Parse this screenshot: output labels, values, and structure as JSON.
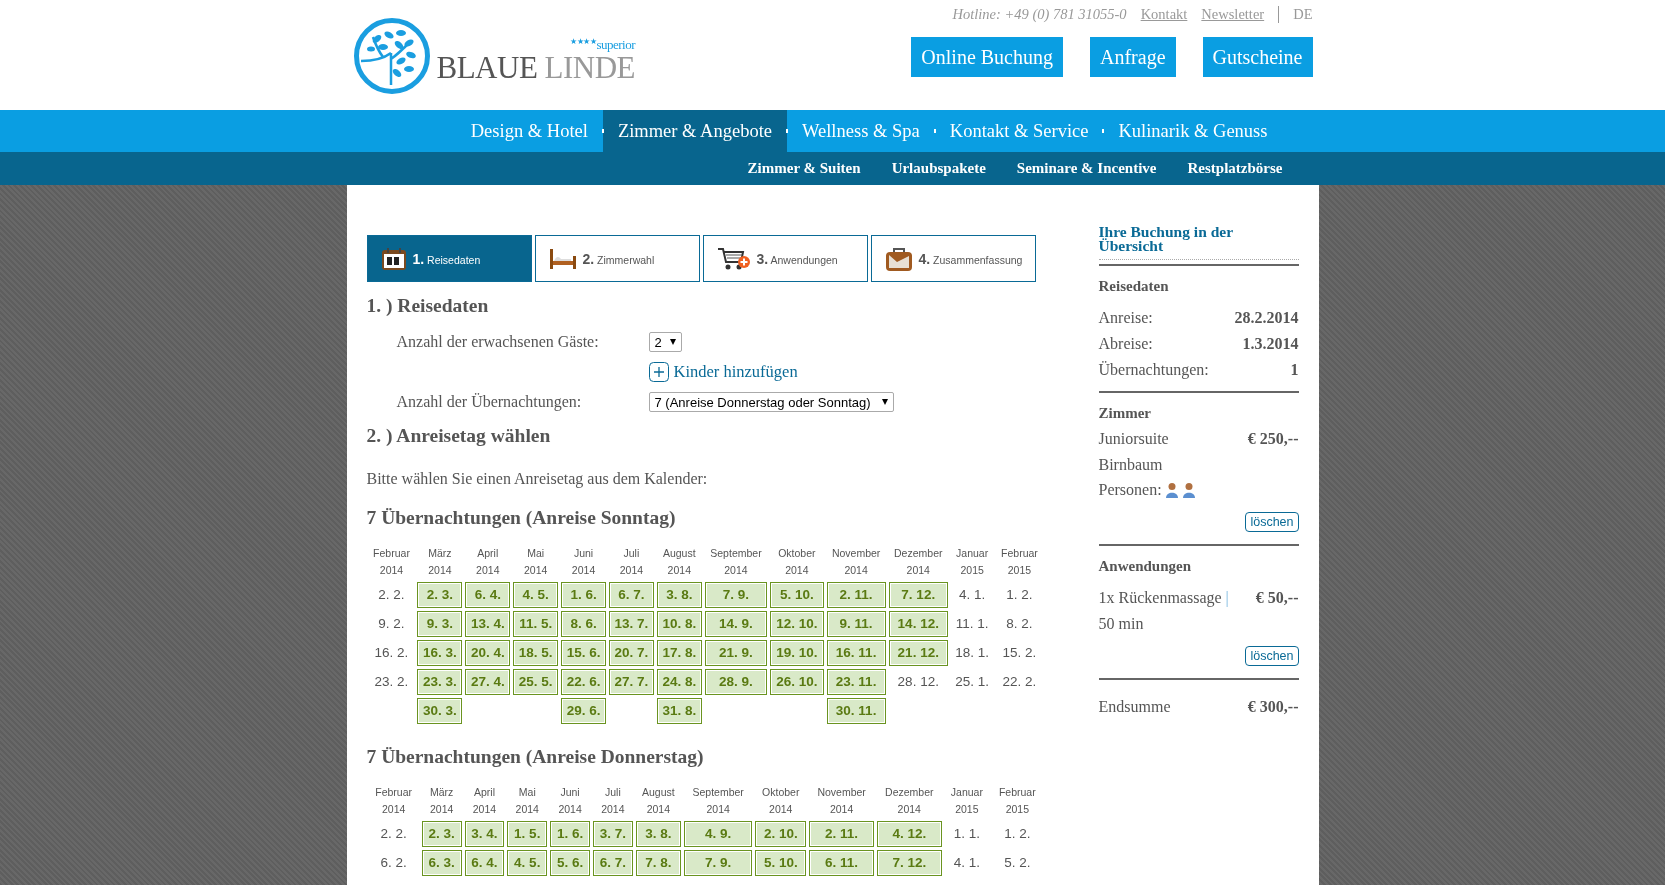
{
  "header": {
    "logo": {
      "brand_first": "BLAUE",
      "brand_second": "LINDE",
      "stars": "★★★★",
      "rating": "superior"
    },
    "hotline": "Hotline: +49 (0) 781 31055-0",
    "links": [
      "Kontakt",
      "Newsletter"
    ],
    "language": "DE",
    "buttons": [
      "Online Buchung",
      "Anfrage",
      "Gutscheine"
    ]
  },
  "main_nav": [
    {
      "label": "Design & Hotel",
      "selected": false
    },
    {
      "label": "Zimmer & Angebote",
      "selected": true
    },
    {
      "label": "Wellness & Spa",
      "selected": false
    },
    {
      "label": "Kontakt & Service",
      "selected": false
    },
    {
      "label": "Kulinarik & Genuss",
      "selected": false
    }
  ],
  "sub_nav": [
    "Zimmer & Suiten",
    "Urlaubspakete",
    "Seminare & Incentive",
    "Restplatzbörse"
  ],
  "steps": [
    {
      "number": "1.",
      "label": "Reisedaten",
      "kind": "calendar",
      "selected": true
    },
    {
      "number": "2.",
      "label": "Zimmerwahl",
      "kind": "bed",
      "selected": false
    },
    {
      "number": "3.",
      "label": "Anwendungen",
      "kind": "cart",
      "selected": false
    },
    {
      "number": "4.",
      "label": "Zusammenfassung",
      "kind": "suitcase",
      "selected": false
    }
  ],
  "travel_dates": {
    "heading": "1. ) Reisedaten",
    "guests_label": "Anzahl der erwachsenen Gäste:",
    "guests_value": "2",
    "add_children": "Kinder hinzufügen",
    "nights_label": "Anzahl der Übernachtungen:",
    "nights_value": "7 (Anreise Donnerstag oder Sonntag)"
  },
  "arrival": {
    "heading": "2. ) Anreisetag wählen",
    "instruction": "Bitte wählen Sie einen Anreisetag aus dem Kalender:"
  },
  "calendars": [
    {
      "title": "7 Übernachtungen (Anreise Sonntag)",
      "months": [
        {
          "name": "Februar",
          "year": "2014",
          "days": [
            {
              "label": "2. 2.",
              "available": false
            },
            {
              "label": "9. 2.",
              "available": false
            },
            {
              "label": "16. 2.",
              "available": false
            },
            {
              "label": "23. 2.",
              "available": false
            }
          ]
        },
        {
          "name": "März",
          "year": "2014",
          "days": [
            {
              "label": "2. 3.",
              "available": true
            },
            {
              "label": "9. 3.",
              "available": true
            },
            {
              "label": "16. 3.",
              "available": true
            },
            {
              "label": "23. 3.",
              "available": true
            },
            {
              "label": "30. 3.",
              "available": true
            }
          ]
        },
        {
          "name": "April",
          "year": "2014",
          "days": [
            {
              "label": "6. 4.",
              "available": true
            },
            {
              "label": "13. 4.",
              "available": true
            },
            {
              "label": "20. 4.",
              "available": true
            },
            {
              "label": "27. 4.",
              "available": true
            }
          ]
        },
        {
          "name": "Mai",
          "year": "2014",
          "days": [
            {
              "label": "4. 5.",
              "available": true
            },
            {
              "label": "11. 5.",
              "available": true
            },
            {
              "label": "18. 5.",
              "available": true
            },
            {
              "label": "25. 5.",
              "available": true
            }
          ]
        },
        {
          "name": "Juni",
          "year": "2014",
          "days": [
            {
              "label": "1. 6.",
              "available": true
            },
            {
              "label": "8. 6.",
              "available": true
            },
            {
              "label": "15. 6.",
              "available": true
            },
            {
              "label": "22. 6.",
              "available": true
            },
            {
              "label": "29. 6.",
              "available": true
            }
          ]
        },
        {
          "name": "Juli",
          "year": "2014",
          "days": [
            {
              "label": "6. 7.",
              "available": true
            },
            {
              "label": "13. 7.",
              "available": true
            },
            {
              "label": "20. 7.",
              "available": true
            },
            {
              "label": "27. 7.",
              "available": true
            }
          ]
        },
        {
          "name": "August",
          "year": "2014",
          "days": [
            {
              "label": "3. 8.",
              "available": true
            },
            {
              "label": "10. 8.",
              "available": true
            },
            {
              "label": "17. 8.",
              "available": true
            },
            {
              "label": "24. 8.",
              "available": true
            },
            {
              "label": "31. 8.",
              "available": true
            }
          ]
        },
        {
          "name": "September",
          "year": "2014",
          "days": [
            {
              "label": "7. 9.",
              "available": true
            },
            {
              "label": "14. 9.",
              "available": true
            },
            {
              "label": "21. 9.",
              "available": true
            },
            {
              "label": "28. 9.",
              "available": true
            }
          ]
        },
        {
          "name": "Oktober",
          "year": "2014",
          "days": [
            {
              "label": "5. 10.",
              "available": true
            },
            {
              "label": "12. 10.",
              "available": true
            },
            {
              "label": "19. 10.",
              "available": true
            },
            {
              "label": "26. 10.",
              "available": true
            }
          ]
        },
        {
          "name": "November",
          "year": "2014",
          "days": [
            {
              "label": "2. 11.",
              "available": true
            },
            {
              "label": "9. 11.",
              "available": true
            },
            {
              "label": "16. 11.",
              "available": true
            },
            {
              "label": "23. 11.",
              "available": true
            },
            {
              "label": "30. 11.",
              "available": true
            }
          ]
        },
        {
          "name": "Dezember",
          "year": "2014",
          "days": [
            {
              "label": "7. 12.",
              "available": true
            },
            {
              "label": "14. 12.",
              "available": true
            },
            {
              "label": "21. 12.",
              "available": true
            },
            {
              "label": "28. 12.",
              "available": false
            }
          ]
        },
        {
          "name": "Januar",
          "year": "2015",
          "days": [
            {
              "label": "4. 1.",
              "available": false
            },
            {
              "label": "11. 1.",
              "available": false
            },
            {
              "label": "18. 1.",
              "available": false
            },
            {
              "label": "25. 1.",
              "available": false
            }
          ]
        },
        {
          "name": "Februar",
          "year": "2015",
          "days": [
            {
              "label": "1. 2.",
              "available": false
            },
            {
              "label": "8. 2.",
              "available": false
            },
            {
              "label": "15. 2.",
              "available": false
            },
            {
              "label": "22. 2.",
              "available": false
            }
          ]
        }
      ]
    },
    {
      "title": "7 Übernachtungen (Anreise Donnerstag)",
      "months": [
        {
          "name": "Februar",
          "year": "2014",
          "days": [
            {
              "label": "2. 2.",
              "available": false
            },
            {
              "label": "6. 2.",
              "available": false
            }
          ]
        },
        {
          "name": "März",
          "year": "2014",
          "days": [
            {
              "label": "2. 3.",
              "available": true
            },
            {
              "label": "6. 3.",
              "available": true
            }
          ]
        },
        {
          "name": "April",
          "year": "2014",
          "days": [
            {
              "label": "3. 4.",
              "available": true
            },
            {
              "label": "6. 4.",
              "available": true
            }
          ]
        },
        {
          "name": "Mai",
          "year": "2014",
          "days": [
            {
              "label": "1. 5.",
              "available": true
            },
            {
              "label": "4. 5.",
              "available": true
            }
          ]
        },
        {
          "name": "Juni",
          "year": "2014",
          "days": [
            {
              "label": "1. 6.",
              "available": true
            },
            {
              "label": "5. 6.",
              "available": true
            }
          ]
        },
        {
          "name": "Juli",
          "year": "2014",
          "days": [
            {
              "label": "3. 7.",
              "available": true
            },
            {
              "label": "6. 7.",
              "available": true
            }
          ]
        },
        {
          "name": "August",
          "year": "2014",
          "days": [
            {
              "label": "3. 8.",
              "available": true
            },
            {
              "label": "7. 8.",
              "available": true
            }
          ]
        },
        {
          "name": "September",
          "year": "2014",
          "days": [
            {
              "label": "4. 9.",
              "available": true
            },
            {
              "label": "7. 9.",
              "available": true
            }
          ]
        },
        {
          "name": "Oktober",
          "year": "2014",
          "days": [
            {
              "label": "2. 10.",
              "available": true
            },
            {
              "label": "5. 10.",
              "available": true
            }
          ]
        },
        {
          "name": "November",
          "year": "2014",
          "days": [
            {
              "label": "2. 11.",
              "available": true
            },
            {
              "label": "6. 11.",
              "available": true
            }
          ]
        },
        {
          "name": "Dezember",
          "year": "2014",
          "days": [
            {
              "label": "4. 12.",
              "available": true
            },
            {
              "label": "7. 12.",
              "available": true
            }
          ]
        },
        {
          "name": "Januar",
          "year": "2015",
          "days": [
            {
              "label": "1. 1.",
              "available": false
            },
            {
              "label": "4. 1.",
              "available": false
            }
          ]
        },
        {
          "name": "Februar",
          "year": "2015",
          "days": [
            {
              "label": "1. 2.",
              "available": false
            },
            {
              "label": "5. 2.",
              "available": false
            }
          ]
        }
      ]
    }
  ],
  "summary": {
    "title": "Ihre Buchung in der Übersicht",
    "dates": {
      "heading": "Reisedaten",
      "rows": [
        {
          "label": "Anreise:",
          "value": "28.2.2014"
        },
        {
          "label": "Abreise:",
          "value": "1.3.2014"
        },
        {
          "label": "Übernachtungen:",
          "value": "1"
        }
      ]
    },
    "room": {
      "heading": "Zimmer",
      "name": "Juniorsuite",
      "price": "€ 250,--",
      "subtitle": "Birnbaum",
      "persons_label": "Personen:",
      "persons": [
        {
          "kind": "adult"
        },
        {
          "kind": "adult"
        }
      ],
      "delete_button": "löschen"
    },
    "treatments": {
      "heading": "Anwendungen",
      "name": "1x Rückenmassage",
      "separator": "|",
      "price": "€ 50,--",
      "duration": "50 min",
      "delete_button": "löschen"
    },
    "total": {
      "label": "Endsumme",
      "value": "€ 300,--"
    }
  }
}
